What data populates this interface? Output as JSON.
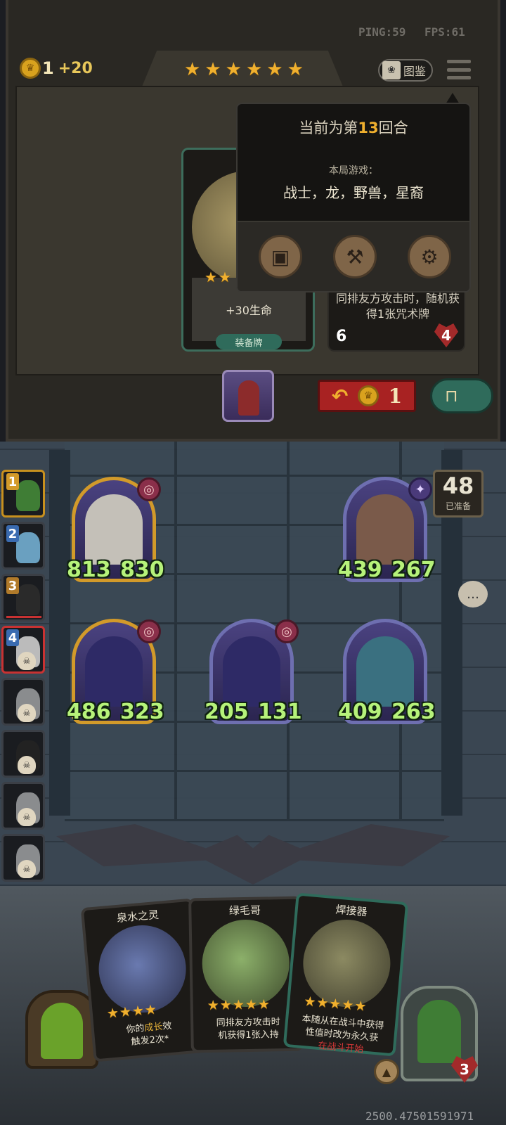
{
  "perf": {
    "ping": "PING:59",
    "fps": "FPS:61"
  },
  "gold": {
    "icon": "crown-coin-icon",
    "value": "1",
    "income": "+20"
  },
  "tavern_stars": [
    "★",
    "★",
    "★",
    "★",
    "★",
    "★"
  ],
  "codex": {
    "label": "图鉴",
    "icon": "book-icon"
  },
  "menu": {
    "icon": "hamburger-menu-icon"
  },
  "info_panel": {
    "round_prefix": "当前为第",
    "round_number": "13",
    "round_suffix": "回合",
    "tribes_title": "本局游戏：",
    "tribes": "战士，龙，野兽，星裔",
    "icons": [
      "card-book-icon",
      "axe-icon",
      "gear-icon"
    ]
  },
  "shop_cards": [
    {
      "stars": [
        "★",
        "★"
      ],
      "text": "+30生命",
      "type_label": "装备牌"
    },
    {
      "text": "同排友方攻击时，随机获得1张咒术牌",
      "attack": "6",
      "health": "4"
    }
  ],
  "refresh": {
    "cost": "1",
    "icon": "refresh-arrow-icon"
  },
  "lock": {
    "icon": "padlock-icon"
  },
  "ready": {
    "count": "48",
    "label": "已准备"
  },
  "ranks": [
    {
      "num": "1",
      "color": "#d29a2a",
      "eliminated": false
    },
    {
      "num": "2",
      "color": "#3a6bb0",
      "eliminated": false
    },
    {
      "num": "3",
      "color": "#b07a2a",
      "eliminated": false
    },
    {
      "num": "4",
      "color": "#3a6bb0",
      "eliminated": true
    },
    {
      "num": "",
      "color": "",
      "eliminated": true
    },
    {
      "num": "",
      "color": "",
      "eliminated": true
    },
    {
      "num": "",
      "color": "",
      "eliminated": true
    },
    {
      "num": "",
      "color": "",
      "eliminated": true
    }
  ],
  "board": [
    {
      "attack": "813",
      "health": "830",
      "golden": true,
      "badge": "swirl"
    },
    {
      "attack": "439",
      "health": "267",
      "golden": false,
      "badge": "star"
    },
    {
      "attack": "486",
      "health": "323",
      "golden": true,
      "badge": "swirl"
    },
    {
      "attack": "205",
      "health": "131",
      "golden": false,
      "badge": "swirl"
    },
    {
      "attack": "409",
      "health": "263",
      "golden": false,
      "badge": ""
    }
  ],
  "hand": [
    {
      "title": "泉水之灵",
      "stars": [
        "★",
        "★",
        "★",
        "★"
      ],
      "text_a": "你的",
      "text_hl": "成长",
      "text_b": "效",
      "text_line2": "触发2次*"
    },
    {
      "title": "绿毛哥",
      "stars": [
        "★",
        "★",
        "★",
        "★",
        "★"
      ],
      "text_a": "同排友方攻击时",
      "text_hl": "",
      "text_b": "",
      "text_line2": "机获得1张入持"
    },
    {
      "title": "焊接器",
      "stars": [
        "★",
        "★",
        "★",
        "★",
        "★"
      ],
      "text_a": "本随从在战斗中获得",
      "text_hl": "",
      "text_b": "",
      "text_line2": "性值时改为永久获",
      "text_line3": "在战斗开始"
    }
  ],
  "player": {
    "health": "3"
  },
  "footer": {
    "value": "2500.47501591971"
  }
}
